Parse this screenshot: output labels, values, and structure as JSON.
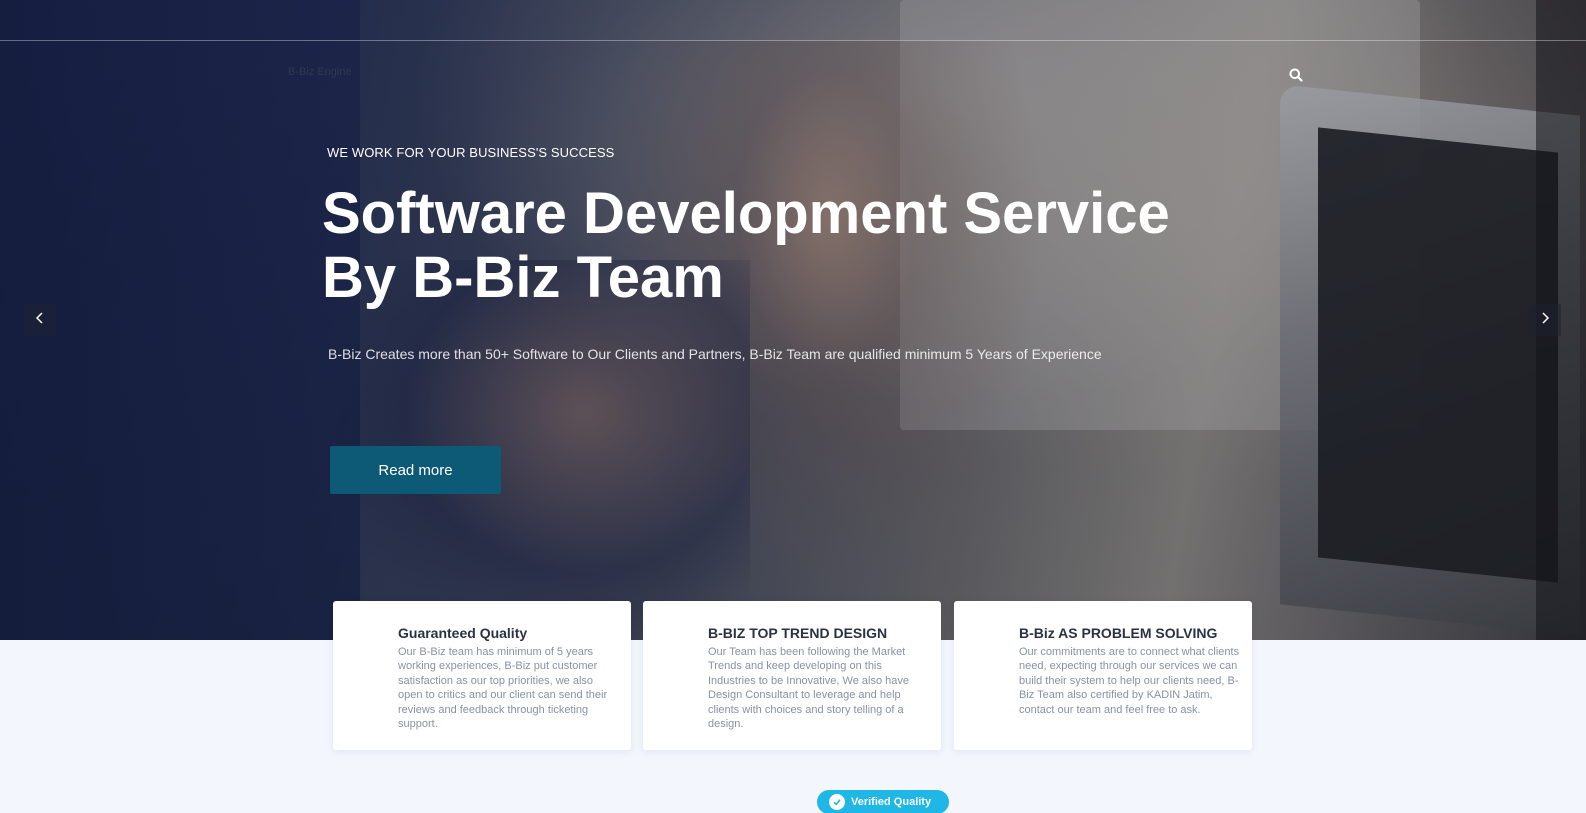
{
  "header": {
    "brand": "B-Biz Engine",
    "search_icon": "search-icon"
  },
  "hero": {
    "eyebrow": "WE WORK FOR YOUR BUSINESS'S SUCCESS",
    "headline_line1": "Software Development Service",
    "headline_line2": "By B-Biz Team",
    "subtext": "B-Biz Creates more than 50+ Software to Our Clients and Partners, B-Biz Team are qualified minimum 5 Years of Experience",
    "cta_label": "Read more",
    "prev_icon": "chevron-left-icon",
    "next_icon": "chevron-right-icon"
  },
  "features": [
    {
      "title": "Guaranteed Quality",
      "text": "Our B-Biz team has minimum of 5 years working experiences, B-Biz put customer satisfaction as our top priorities, we also open to critics and our client can send their reviews and feedback through ticketing support."
    },
    {
      "title": "B-BIZ TOP TREND DESIGN",
      "text": "Our Team has been following the Market Trends and keep developing on this Industries to be Innovative, We also have Design Consultant to leverage and help clients with choices and story telling of a design."
    },
    {
      "title": "B-Biz AS PROBLEM SOLVING",
      "text": "Our commitments are to connect what clients need, expecting through our services we can build their system to help our clients need, B-Biz Team also certified by KADIN Jatim, contact our team and feel free to ask."
    }
  ],
  "badge": {
    "label": "Verified Quality",
    "icon": "check-circle-icon"
  },
  "colors": {
    "cta": "#0c5a76",
    "badge": "#1fb7e6",
    "page_bg": "#f3f6fd"
  }
}
